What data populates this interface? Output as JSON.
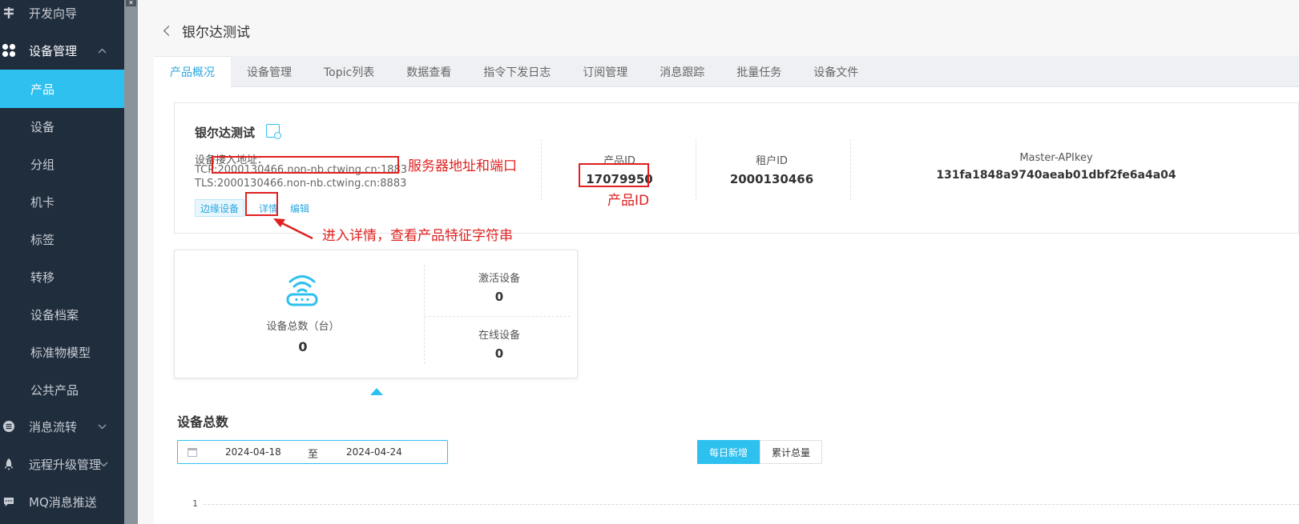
{
  "sidebar": {
    "items": [
      {
        "label": "开发向导",
        "icon": "compass-icon"
      },
      {
        "label": "设备管理",
        "icon": "grid-icon",
        "expanded": true
      },
      {
        "label": "产品",
        "active": true
      },
      {
        "label": "设备"
      },
      {
        "label": "分组"
      },
      {
        "label": "机卡"
      },
      {
        "label": "标签"
      },
      {
        "label": "转移"
      },
      {
        "label": "设备档案"
      },
      {
        "label": "标准物模型"
      },
      {
        "label": "公共产品"
      },
      {
        "label": "消息流转",
        "icon": "list-circle-icon"
      },
      {
        "label": "远程升级管理",
        "icon": "rocket-icon"
      },
      {
        "label": "MQ消息推送",
        "icon": "chat-icon"
      }
    ],
    "accent": "#2ec0ef"
  },
  "header": {
    "title": "银尔达测试"
  },
  "tabs": [
    "产品概况",
    "设备管理",
    "Topic列表",
    "数据查看",
    "指令下发日志",
    "订阅管理",
    "消息跟踪",
    "批量任务",
    "设备文件"
  ],
  "product": {
    "name": "银尔达测试",
    "address_label": "设备接入地址：",
    "tcp_prefix": "TCP:",
    "tcp_address": "2000130466.non-nb.ctwing.cn:1883",
    "tls": "TLS:2000130466.non-nb.ctwing.cn:8883",
    "tags": {
      "edge": "边缘设备",
      "detail": "详情",
      "edit": "编辑"
    },
    "product_id_label": "产品ID",
    "product_id": "17079950",
    "tenant_id_label": "租户ID",
    "tenant_id": "2000130466",
    "apikey_label": "Master-APIkey",
    "apikey": "131fa1848a9740aeab01dbf2fe6a4a04"
  },
  "annotations": {
    "server": "服务器地址和端口",
    "product_id": "产品ID",
    "detail": "进入详情，查看产品特征字符串",
    "color": "#e02020"
  },
  "devices": {
    "total_label": "设备总数（台）",
    "total": "0",
    "active_label": "激活设备",
    "active": "0",
    "online_label": "在线设备",
    "online": "0"
  },
  "chart": {
    "title": "设备总数",
    "start_date": "2024-04-18",
    "separator": "至",
    "end_date": "2024-04-24",
    "daily_label": "每日新增",
    "cumulative_label": "累计总量",
    "y_tick": "1"
  }
}
